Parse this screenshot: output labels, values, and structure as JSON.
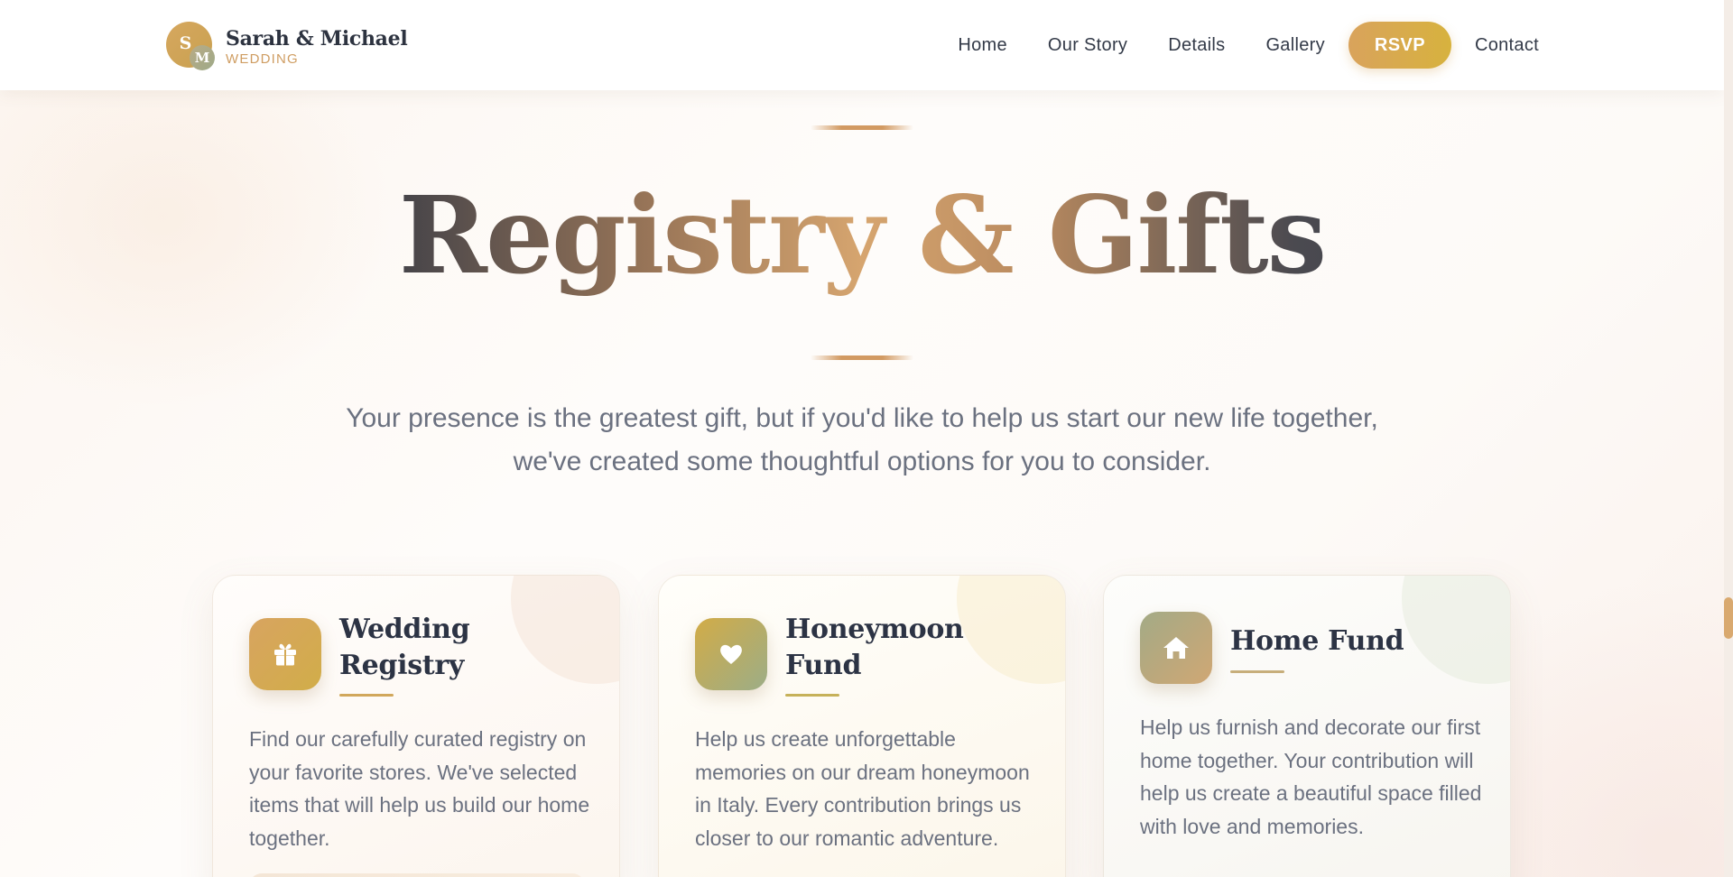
{
  "header": {
    "monogram_primary": "S",
    "monogram_secondary": "M",
    "couple_name": "Sarah & Michael",
    "subtitle": "WEDDING",
    "nav": {
      "home": "Home",
      "our_story": "Our Story",
      "details": "Details",
      "gallery": "Gallery",
      "rsvp": "RSVP",
      "contact": "Contact"
    }
  },
  "hero": {
    "title": "Registry & Gifts",
    "intro": "Your presence is the greatest gift, but if you'd like to help us start our new life together, we've created some thoughtful options for you to consider."
  },
  "cards": [
    {
      "icon": "gift-icon",
      "title": "Wedding Registry",
      "body": "Find our carefully curated registry on your favorite stores. We've selected items that will help us build our home together."
    },
    {
      "icon": "heart-icon",
      "title": "Honeymoon Fund",
      "body": "Help us create unforgettable memories on our dream honeymoon in Italy. Every contribution brings us closer to our romantic adventure."
    },
    {
      "icon": "home-icon",
      "title": "Home Fund",
      "body": "Help us furnish and decorate our first home together. Your contribution will help us create a beautiful space filled with love and memories."
    }
  ],
  "colors": {
    "accent_gold": "#d6a75f",
    "heading_dark": "#2c3344",
    "body_gray": "#6b7180",
    "sage": "#9eaa88"
  }
}
